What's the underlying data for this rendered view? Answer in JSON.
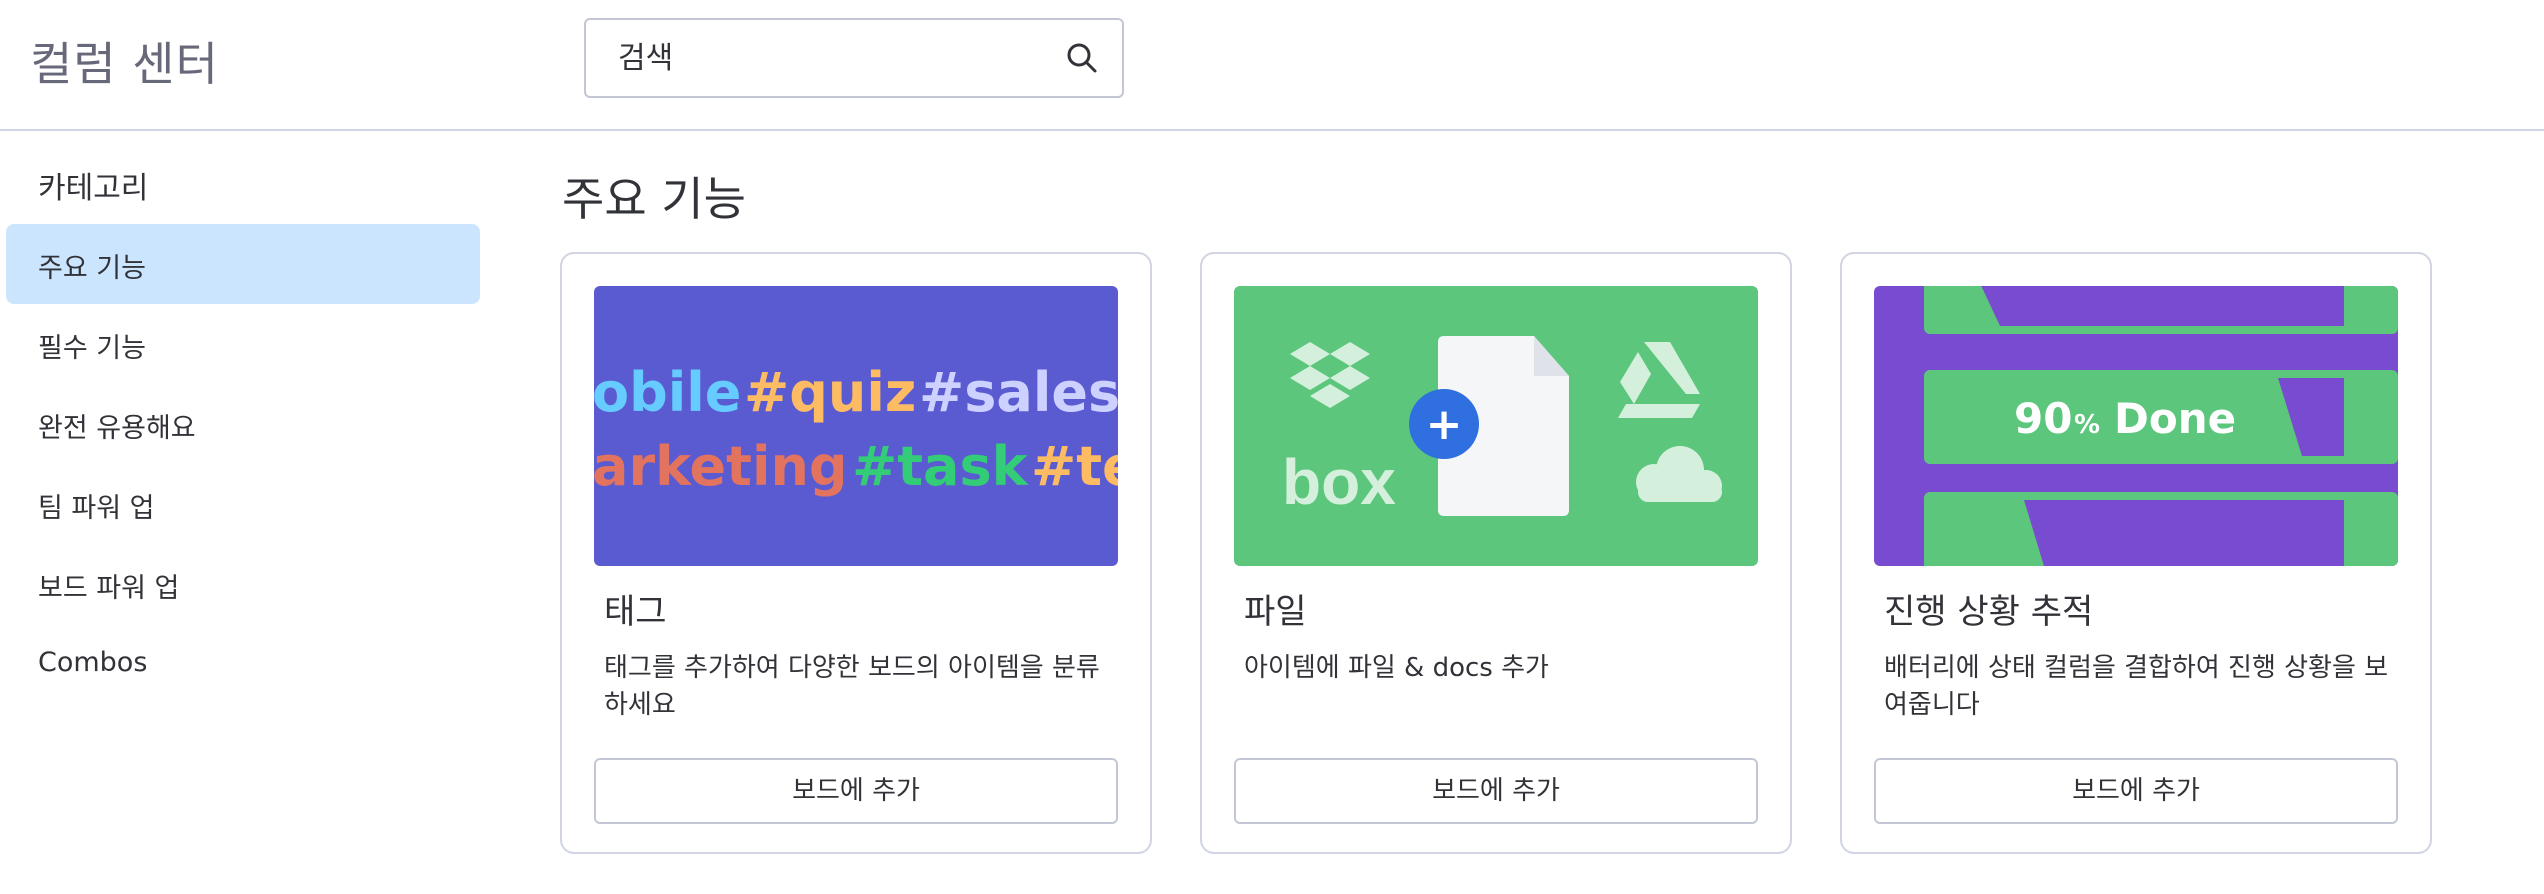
{
  "header": {
    "title": "컬럼 센터",
    "search_placeholder": "검색"
  },
  "sidebar": {
    "title": "카테고리",
    "items": [
      {
        "label": "주요 기능",
        "active": true
      },
      {
        "label": "필수 기능",
        "active": false
      },
      {
        "label": "완전 유용해요",
        "active": false
      },
      {
        "label": "팀 파워 업",
        "active": false
      },
      {
        "label": "보드 파워 업",
        "active": false
      },
      {
        "label": "Combos",
        "active": false
      }
    ]
  },
  "main": {
    "title": "주요 기능",
    "cards": [
      {
        "title": "태그",
        "description": "태그를 추가하여 다양한 보드의 아이템을 분류하세요",
        "button_label": "보드에 추가",
        "image": {
          "background": "#5b5bd1",
          "line1": [
            "obile",
            "#quiz",
            "#sales"
          ],
          "line2": [
            "arketing",
            "#task",
            "#te"
          ],
          "colors": [
            "#66ccff",
            "#fdbc64",
            "#cdd1ff",
            "#e2735f",
            "#33cc77",
            "#fdbc64"
          ]
        }
      },
      {
        "title": "파일",
        "description": "아이템에 파일 & docs 추가",
        "button_label": "보드에 추가",
        "image": {
          "background": "#5cc67c",
          "box_label": "box",
          "plus": "+"
        }
      },
      {
        "title": "진행 상황 추적",
        "description": "배터리에 상태 컬럼을 결합하여 진행 상황을 보여줍니다",
        "button_label": "보드에 추가",
        "image": {
          "background": "#784bd1",
          "bar_color": "#5cc67c",
          "progress_value": "90",
          "progress_unit": "%",
          "progress_label": "Done"
        }
      }
    ]
  }
}
